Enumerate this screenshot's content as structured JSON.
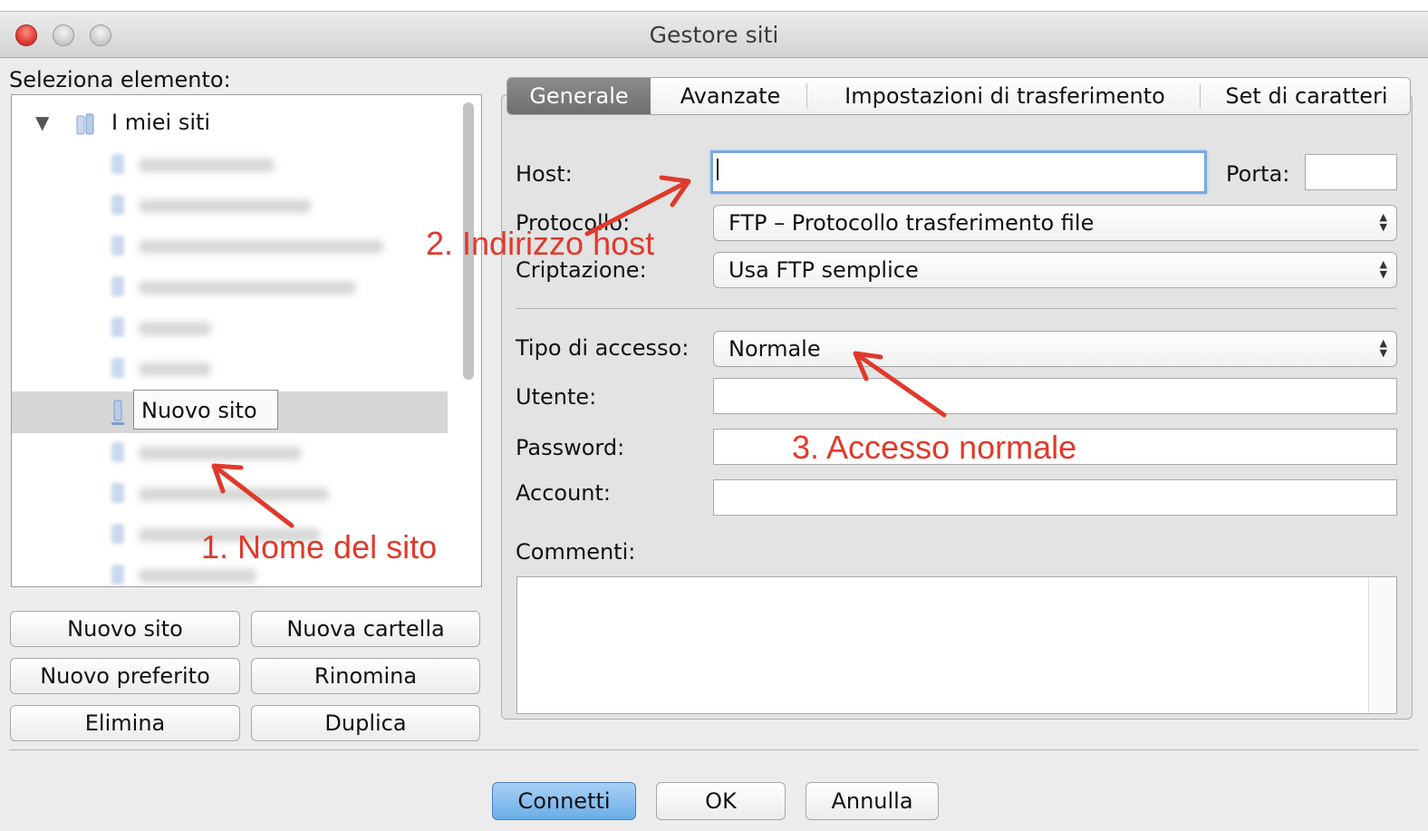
{
  "window": {
    "title": "Gestore siti"
  },
  "left": {
    "label": "Seleziona elemento:",
    "tree": {
      "root": "I miei siti",
      "selected_item": "Nuovo sito"
    },
    "buttons": {
      "new_site": "Nuovo sito",
      "new_folder": "Nuova cartella",
      "new_bookmark": "Nuovo preferito",
      "rename": "Rinomina",
      "delete": "Elimina",
      "duplicate": "Duplica"
    }
  },
  "tabs": [
    "Generale",
    "Avanzate",
    "Impostazioni di trasferimento",
    "Set di caratteri"
  ],
  "general": {
    "host_label": "Host:",
    "host_value": "",
    "port_label": "Porta:",
    "port_value": "",
    "protocol_label": "Protocollo:",
    "protocol_value": "FTP – Protocollo trasferimento file",
    "encryption_label": "Criptazione:",
    "encryption_value": "Usa FTP semplice",
    "logon_label": "Tipo di accesso:",
    "logon_value": "Normale",
    "user_label": "Utente:",
    "password_label": "Password:",
    "account_label": "Account:",
    "comments_label": "Commenti:"
  },
  "annotations": {
    "a1": "1. Nome del sito",
    "a2": "2. Indirizzo host",
    "a3": "3. Accesso normale"
  },
  "footer": {
    "connect": "Connetti",
    "ok": "OK",
    "cancel": "Annulla"
  },
  "colors": {
    "annotation": "#e0392b",
    "focus": "#79a9e0",
    "primary_button": "#6aaee9"
  }
}
